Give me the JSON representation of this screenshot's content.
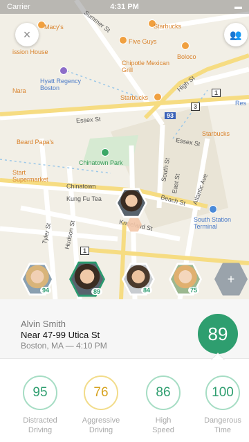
{
  "status_bar": {
    "carrier": "Carrier",
    "time": "4:31 PM",
    "battery": "▬"
  },
  "map": {
    "streets": [
      "Summer St",
      "Essex St",
      "Essex St",
      "Beach St",
      "South St",
      "Atlantic Ave",
      "Kneeland St",
      "Hudson St",
      "Tyler St",
      "High St",
      "East St",
      "Chinatown"
    ],
    "places": {
      "macys": "Macy's",
      "starbucks1": "Starbucks",
      "five_guys": "Five Guys",
      "boloco": "Boloco",
      "chipotle": "Chipotle Mexican Grill",
      "hyatt": "Hyatt Regency Boston",
      "starbucks2": "Starbucks",
      "starbucks3": "Starbucks",
      "beard_papa": "Beard Papa's",
      "chinatown_park": "Chinatown Park",
      "supermarket": "Start Supermarket",
      "kung_fu": "Kung Fu Tea",
      "south_station": "South Station Terminal",
      "house": "ission House",
      "nara": "Nara",
      "res": "Res"
    },
    "route_shields": [
      "1",
      "3",
      "93",
      "1"
    ]
  },
  "buttons": {
    "close_icon": "×",
    "group_icon": "👥",
    "add_person_icon": "+"
  },
  "avatars": [
    {
      "score": "94"
    },
    {
      "score": "89"
    },
    {
      "score": "84"
    },
    {
      "score": "75"
    }
  ],
  "driver": {
    "name": "Alvin Smith",
    "address": "Near 47-99 Utica St",
    "location_time": "Boston, MA — 4:10 PM",
    "score": "89"
  },
  "metrics": [
    {
      "value": "95",
      "label_line1": "Distracted",
      "label_line2": "Driving"
    },
    {
      "value": "76",
      "label_line1": "Aggressive",
      "label_line2": "Driving"
    },
    {
      "value": "86",
      "label_line1": "High",
      "label_line2": "Speed"
    },
    {
      "value": "100",
      "label_line1": "Dangerous",
      "label_line2": "Time"
    }
  ],
  "colors": {
    "accent": "#2e9e6f",
    "warning": "#d6a21e",
    "map_bg": "#f2efe6"
  }
}
